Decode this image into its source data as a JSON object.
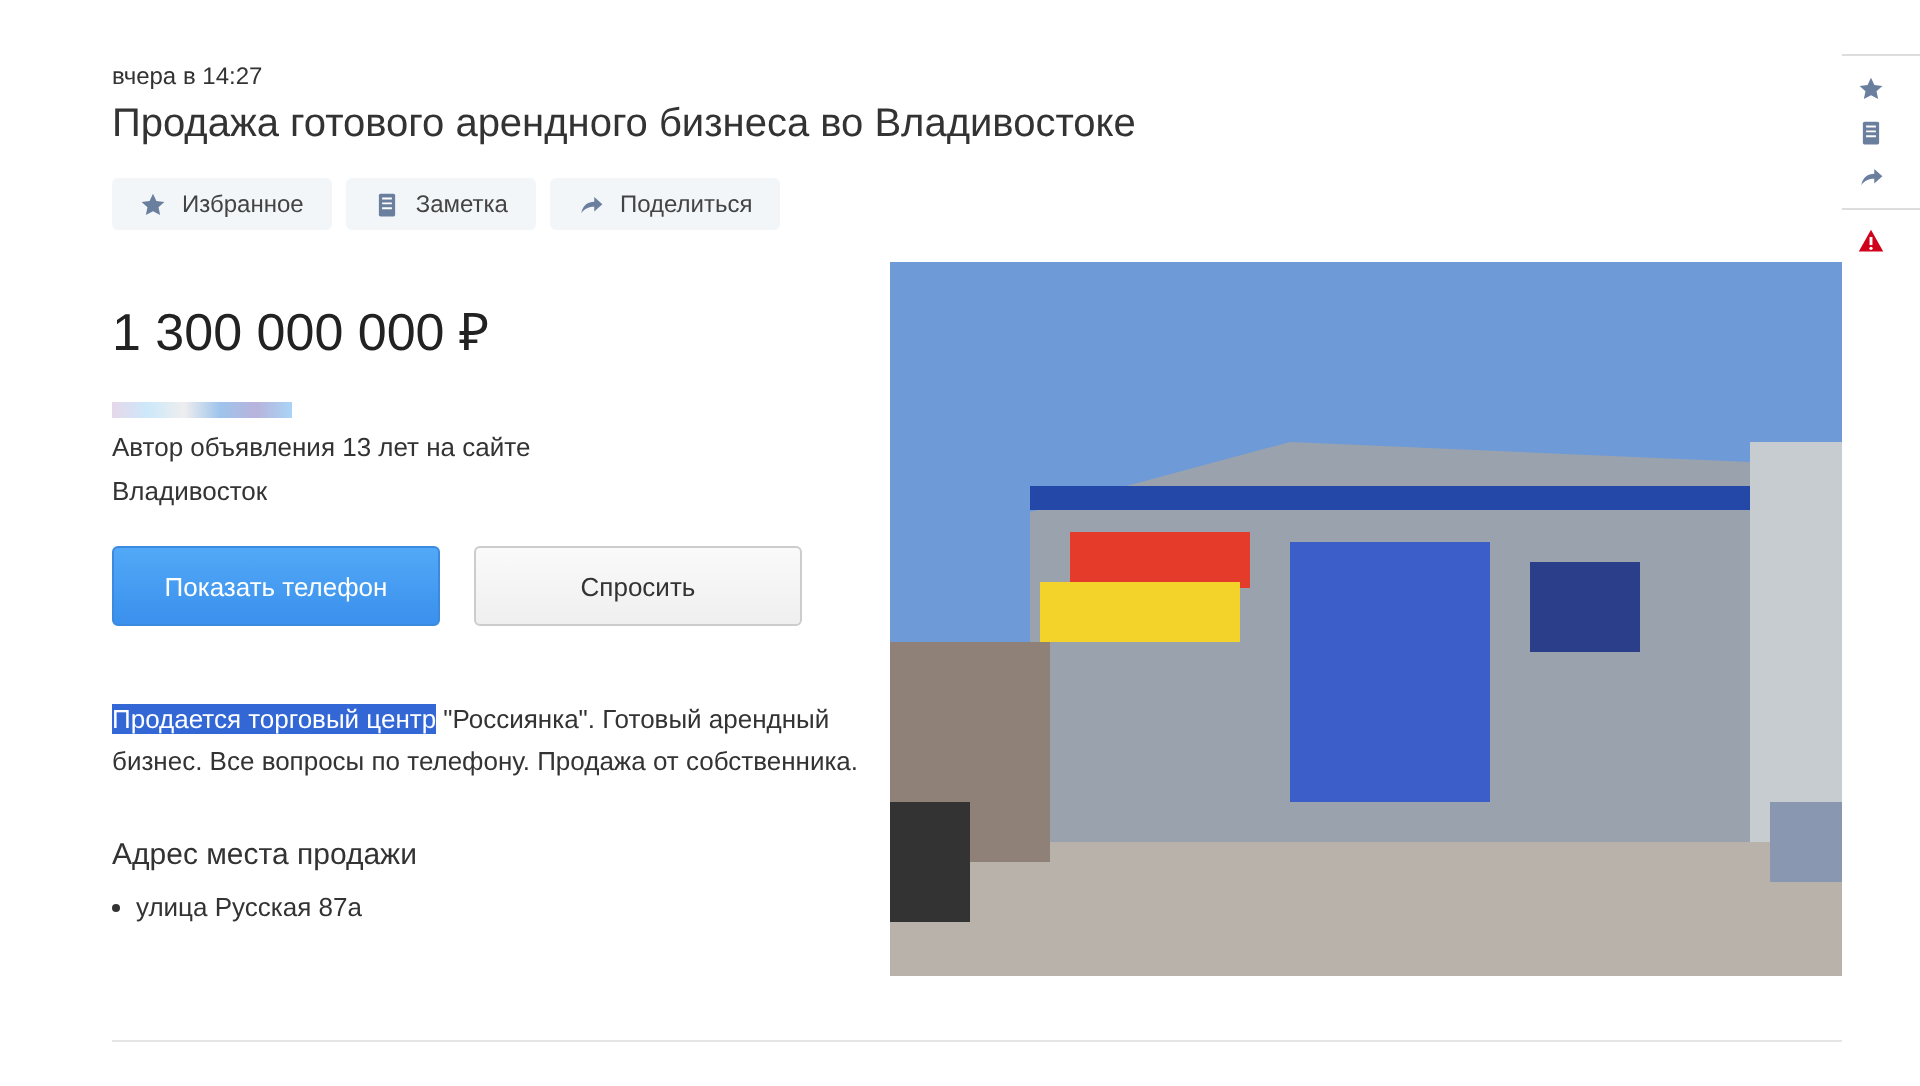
{
  "date": "вчера в 14:27",
  "title": "Продажа готового арендного бизнеса во Владивостоке",
  "actions": [
    {
      "kind": "star",
      "label": "Избранное"
    },
    {
      "kind": "note",
      "label": "Заметка"
    },
    {
      "kind": "share",
      "label": "Поделиться"
    }
  ],
  "price": "1 300 000 000 ₽",
  "author_note": "Автор объявления 13 лет на сайте",
  "city": "Владивосток",
  "buttons": [
    {
      "kind": "primary",
      "label": "Показать телефон"
    },
    {
      "kind": "secondary",
      "label": "Спросить"
    }
  ],
  "description": {
    "selected_part": "Продается торговый центр",
    "rest": " \"Россиянка\". Готовый арендный бизнес. Все вопросы по телефону. Продажа от собственника."
  },
  "address": {
    "heading": "Адрес места продажи",
    "items": [
      "улица Русская 87а"
    ]
  },
  "side_icons": [
    {
      "kind": "star"
    },
    {
      "kind": "note"
    },
    {
      "kind": "share"
    },
    {
      "kind": "warning"
    }
  ]
}
